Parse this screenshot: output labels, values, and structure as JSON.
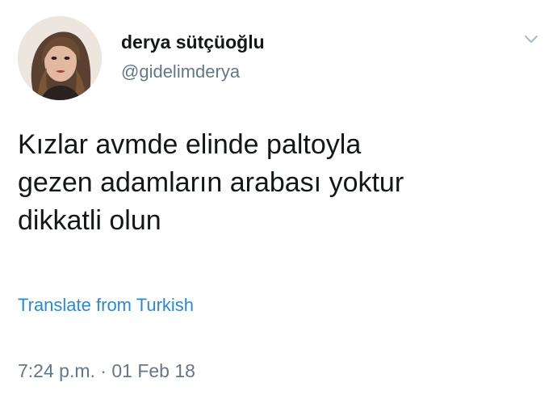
{
  "author": {
    "display_name": "derya sütçüoğlu",
    "handle": "@gidelimderya"
  },
  "tweet": {
    "text_lines": [
      "Kızlar avmde elinde paltoyla",
      "gezen adamların arabası yoktur",
      "dikkatli olun"
    ],
    "translate_label": "Translate from Turkish",
    "time": "7:24 p.m.",
    "separator": " · ",
    "date": "01 Feb 18"
  },
  "icons": {
    "menu": "chevron-down-icon",
    "avatar": "profile-photo"
  },
  "colors": {
    "text": "#14171a",
    "secondary": "#657786",
    "link": "#2b8ac9",
    "caret": "#aab8c2"
  }
}
